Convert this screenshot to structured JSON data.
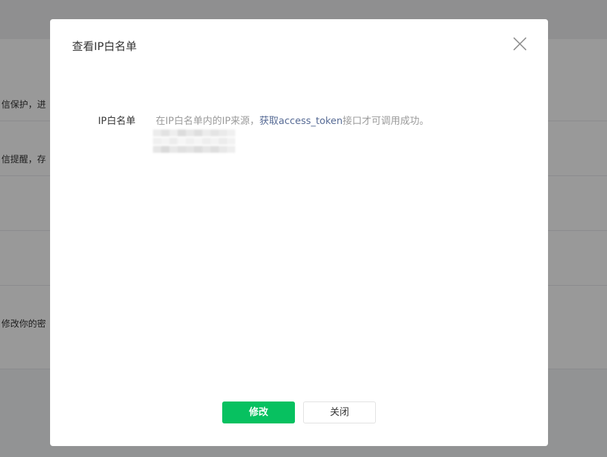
{
  "background": {
    "rows": [
      {
        "text": "信保护，进"
      },
      {
        "text": "信提醒，存"
      },
      {
        "text": ""
      },
      {
        "text": ""
      },
      {
        "text": "修改你的密"
      }
    ]
  },
  "dialog": {
    "title": "查看IP白名单",
    "close_icon": "close-icon",
    "field": {
      "label": "IP白名单",
      "desc_prefix": "在IP白名单内的IP来源，",
      "desc_link": "获取access_token",
      "desc_suffix": "接口才可调用成功。"
    },
    "buttons": {
      "modify": "修改",
      "close": "关闭"
    }
  },
  "colors": {
    "primary": "#07c160",
    "link": "#576b95",
    "muted_text": "#9a9a9a",
    "overlay": "rgba(0,0,0,0.4)"
  }
}
